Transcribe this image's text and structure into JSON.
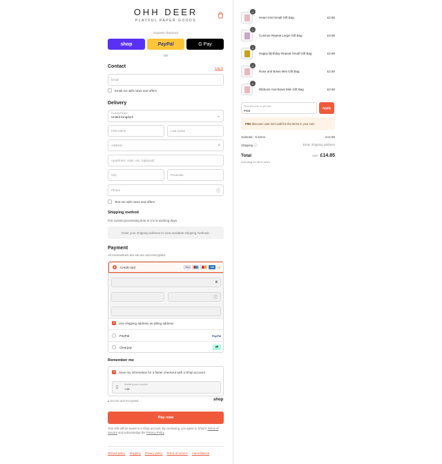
{
  "brand": {
    "name": "OHH DEER",
    "tagline": "PLAYFUL PAPER GOODS"
  },
  "express": {
    "label": "Express checkout",
    "shop": "shop",
    "paypal": "PayPal",
    "gpay": "G Pay",
    "or": "OR"
  },
  "contact": {
    "title": "Contact",
    "login": "Log in",
    "email_placeholder": "Email",
    "news_label": "Email me with news and offers"
  },
  "delivery": {
    "title": "Delivery",
    "country_label": "Country/Region",
    "country_value": "United Kingdom",
    "first_name": "First name",
    "last_name": "Last name",
    "address": "Address",
    "apartment": "Apartment, suite, etc. (optional)",
    "city": "City",
    "postcode": "Postcode",
    "phone": "Phone",
    "text_label": "Text me with news and offers"
  },
  "shipping": {
    "title": "Shipping method",
    "note": "Our current processing time is 3 to 6 working days.",
    "placeholder": "Enter your shipping address to view available shipping methods."
  },
  "payment": {
    "title": "Payment",
    "subtitle": "All transactions are secure and encrypted.",
    "credit_card": "Credit card",
    "more_cards": "+5",
    "billing_label": "Use shipping address as billing address",
    "paypal": "PayPal",
    "paypal_logo": "PayPal",
    "clearpay": "Clearpay"
  },
  "remember": {
    "title": "Remember me",
    "save_label": "Save my information for a faster checkout with a Shop account",
    "phone_label": "Mobile phone number",
    "phone_value": "+44",
    "secure": "Secure and encrypted",
    "shop": "shop"
  },
  "pay_now": "Pay now",
  "legal": {
    "part1": "Your info will be saved to a Shop account. By continuing, you agree to Shop's",
    "tos": "Terms of Service",
    "part2": "and acknowledge the",
    "privacy": "Privacy Policy",
    "end": "."
  },
  "footer": [
    "Refund policy",
    "Shipping",
    "Privacy policy",
    "Terms of service",
    "Cancellations"
  ],
  "items": [
    {
      "name": "Heart Grid Small Gift Bag",
      "price": "£2.95",
      "qty": "1",
      "color": "#e8b9c4"
    },
    {
      "name": "Cosmos Repeat Large Gift Bag",
      "price": "£3.95",
      "qty": "1",
      "color": "#c9a7c9"
    },
    {
      "name": "Happy Birthday Repeat Small Gift Bag",
      "price": "£2.95",
      "qty": "1",
      "color": "#c9a21a"
    },
    {
      "name": "Rose and Bows Mini Gift Bag",
      "price": "£2.50",
      "qty": "1",
      "color": "#e6b8c2"
    },
    {
      "name": "Ribbons And Bows Mini Gift Bag",
      "price": "£2.50",
      "qty": "1",
      "color": "#eab7c4"
    }
  ],
  "discount": {
    "label": "Discount code or gift card",
    "value": "PI50",
    "apply": "Apply"
  },
  "warning": {
    "code": "PI50",
    "text": " discount code isn't valid for the items in your cart"
  },
  "summary": {
    "subtotal_label": "Subtotal · 5 items",
    "subtotal": "£14.85",
    "shipping_label": "Shipping",
    "shipping_value": "Enter shipping address",
    "total_label": "Total",
    "currency": "GBP",
    "total": "£14.85",
    "taxes": "Including £2.48 in taxes"
  },
  "colors": {
    "accent": "#f05a3a",
    "shop": "#5a31f4",
    "paypal": "#ffc439"
  }
}
